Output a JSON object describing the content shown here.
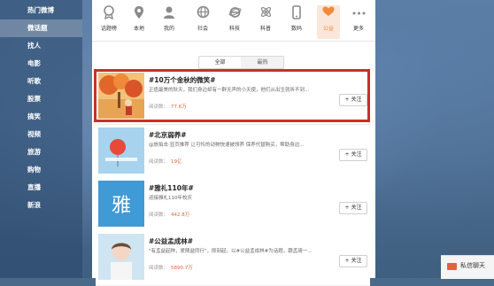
{
  "sidebar": {
    "items": [
      {
        "label": "热门微博"
      },
      {
        "label": "微话题"
      },
      {
        "label": "找人"
      },
      {
        "label": "电影"
      },
      {
        "label": "听歌"
      },
      {
        "label": "股票"
      },
      {
        "label": "搞笑"
      },
      {
        "label": "视频"
      },
      {
        "label": "旅游"
      },
      {
        "label": "购物"
      },
      {
        "label": "直播"
      },
      {
        "label": "新浪"
      }
    ],
    "active_index": 1
  },
  "categories": [
    {
      "label": "话题榜",
      "icon": "badge-icon"
    },
    {
      "label": "本地",
      "icon": "location-pin-icon"
    },
    {
      "label": "我的",
      "icon": "person-icon"
    },
    {
      "label": "社会",
      "icon": "globe-icon"
    },
    {
      "label": "科技",
      "icon": "ie-icon"
    },
    {
      "label": "科普",
      "icon": "atom-icon"
    },
    {
      "label": "数码",
      "icon": "phone-icon"
    },
    {
      "label": "公益",
      "icon": "heart-hand-icon"
    },
    {
      "label": "更多",
      "icon": "more-dots-icon"
    }
  ],
  "active_category_index": 7,
  "tabs": [
    "全部",
    "最热"
  ],
  "topics": [
    {
      "title": "#10万个金秋的微笑#",
      "desc": "正值最美的秋天，我们身边却有一群无声的小天使，他们从出生就听不到...",
      "reads_label": "阅读数：",
      "reads": "77.6万",
      "follow": "+ 关注"
    },
    {
      "title": "#北京弱养#",
      "desc": "@放拍击·显页推荐 让可怜的动物快速被领养 保养代替购买，帮助身边...",
      "reads_label": "阅读数：",
      "reads": "19亿",
      "follow": "+ 关注"
    },
    {
      "title": "#雅礼110年#",
      "desc": "迎接雅礼110年校庆",
      "reads_label": "阅读数：",
      "reads": "442.8万",
      "follow": "+ 关注"
    },
    {
      "title": "#公益孟成林#",
      "desc": "\"有孟益起种，爱随益同行\"，即刻起，以#公益孟成林#为话题，跟孟琦一...",
      "reads_label": "阅读数：",
      "reads": "5890.7万",
      "follow": "+ 关注"
    }
  ],
  "thumb_text": {
    "yali": "雅"
  },
  "chat": {
    "label": "私信聊天"
  },
  "colors": {
    "accent": "#f08a3a",
    "highlight_border": "#c8302b",
    "reads_number": "#e2633a"
  }
}
